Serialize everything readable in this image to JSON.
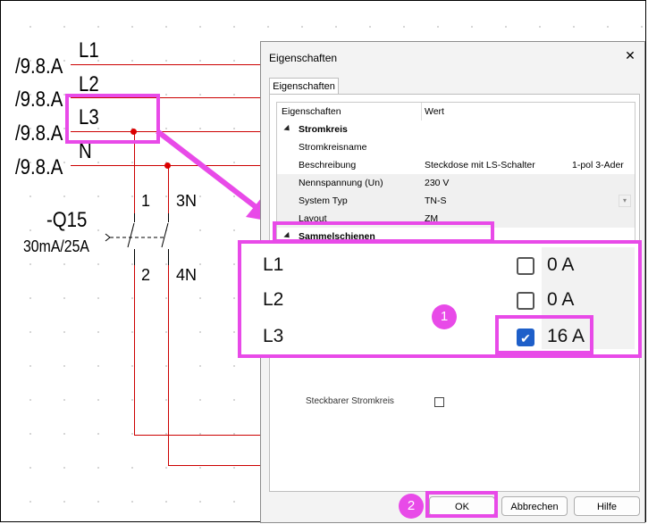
{
  "schematic": {
    "phases": [
      {
        "ref": "/9.8.A",
        "line": "L1"
      },
      {
        "ref": "/9.8.A",
        "line": "L2"
      },
      {
        "ref": "/9.8.A",
        "line": "L3"
      },
      {
        "ref": "/9.8.A",
        "line": "N"
      }
    ],
    "device": {
      "name": "-Q15",
      "rating": "30mA/25A",
      "pin1": "1",
      "pin2": "2",
      "pin3": "3N",
      "pin4": "4N"
    }
  },
  "dialog": {
    "title": "Eigenschaften",
    "close": "✕",
    "tab": "Eigenschaften",
    "table": {
      "col1": "Eigenschaften",
      "col2": "Wert",
      "section1": "Stromkreis",
      "rows": [
        {
          "name": "Stromkreisname",
          "value": "",
          "extra": ""
        },
        {
          "name": "Beschreibung",
          "value": "Steckdose mit LS-Schalter",
          "extra": "1-pol 3-Ader"
        },
        {
          "name": "Nennspannung (Un)",
          "value": "230 V",
          "extra": ""
        },
        {
          "name": "System Typ",
          "value": "TN-S",
          "extra": ""
        },
        {
          "name": "Layout",
          "value": "ZM",
          "extra": ""
        }
      ],
      "section2": "Sammelschienen",
      "hidden_row": "Steckbarer Stromkreis"
    },
    "buttons": {
      "ok": "OK",
      "cancel": "Abbrechen",
      "help": "Hilfe"
    }
  },
  "zoom": {
    "busbars": [
      {
        "label": "L1",
        "checked": false,
        "value": "0 A"
      },
      {
        "label": "L2",
        "checked": false,
        "value": "0 A"
      },
      {
        "label": "L3",
        "checked": true,
        "value": "16 A"
      }
    ],
    "checkmark": "✔"
  },
  "badges": {
    "one": "1",
    "two": "2"
  },
  "colors": {
    "highlight": "#e84ae8",
    "wire": "#cc0000",
    "check": "#1e5fc9"
  }
}
